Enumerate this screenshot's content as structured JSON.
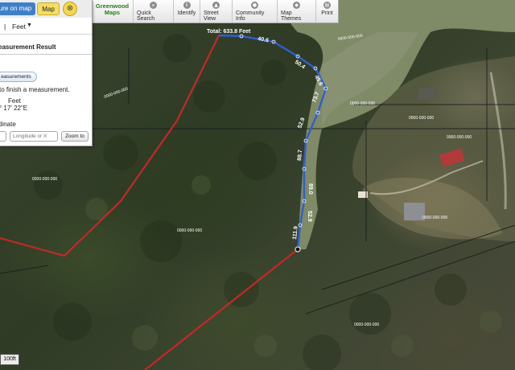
{
  "toolbar": {
    "brand_line1": "Greenwood",
    "brand_line2": "Maps",
    "items": [
      {
        "label": "Quick Search",
        "icon": "search-icon",
        "glyph": "⌕"
      },
      {
        "label": "Identify",
        "icon": "info-icon",
        "glyph": "i"
      },
      {
        "label": "Street View",
        "icon": "street-view-icon",
        "glyph": "▲"
      },
      {
        "label": "Community Info",
        "icon": "community-info-icon",
        "glyph": "●"
      },
      {
        "label": "Map Themes",
        "icon": "map-themes-icon",
        "glyph": "◆"
      },
      {
        "label": "Print",
        "icon": "print-icon",
        "glyph": "▤"
      }
    ]
  },
  "panel": {
    "tab_measure": "ure on map",
    "tab_map": "Map",
    "close_icon": "⊗",
    "unit_separator": "|",
    "unit_value": "Feet",
    "result_title": "easurement Result",
    "measure_button": "easurements",
    "finish_text": "to finish a measurement.",
    "feet_label": "Feet",
    "bearing": "° 17' 22\"E",
    "coordinate_label": "dinate",
    "latitude_placeholder": "",
    "longitude_placeholder": "Longitude or X",
    "zoom_button": "Zoom to"
  },
  "measurement": {
    "total_label": "Total: 633.8 Feet",
    "segments": [
      "40.6",
      "50.4",
      "45.6",
      "73.7",
      "52.9",
      "88.7",
      "89.0",
      "52.9",
      "111.9"
    ]
  },
  "parcels": [
    "0000-000-000",
    "0000-000-000",
    "0000-000-000",
    "0000-000-000",
    "0000-000-000",
    "0000-000-000",
    "0000-000-000",
    "0000-000-000",
    "0000-000-000"
  ],
  "scalebar": {
    "label": "100ft"
  },
  "colors": {
    "measure_line": "#2f5fd0",
    "parcel_line": "#c42828",
    "water": "#7f8a66",
    "toolbar_brand": "#2a7a1f"
  }
}
